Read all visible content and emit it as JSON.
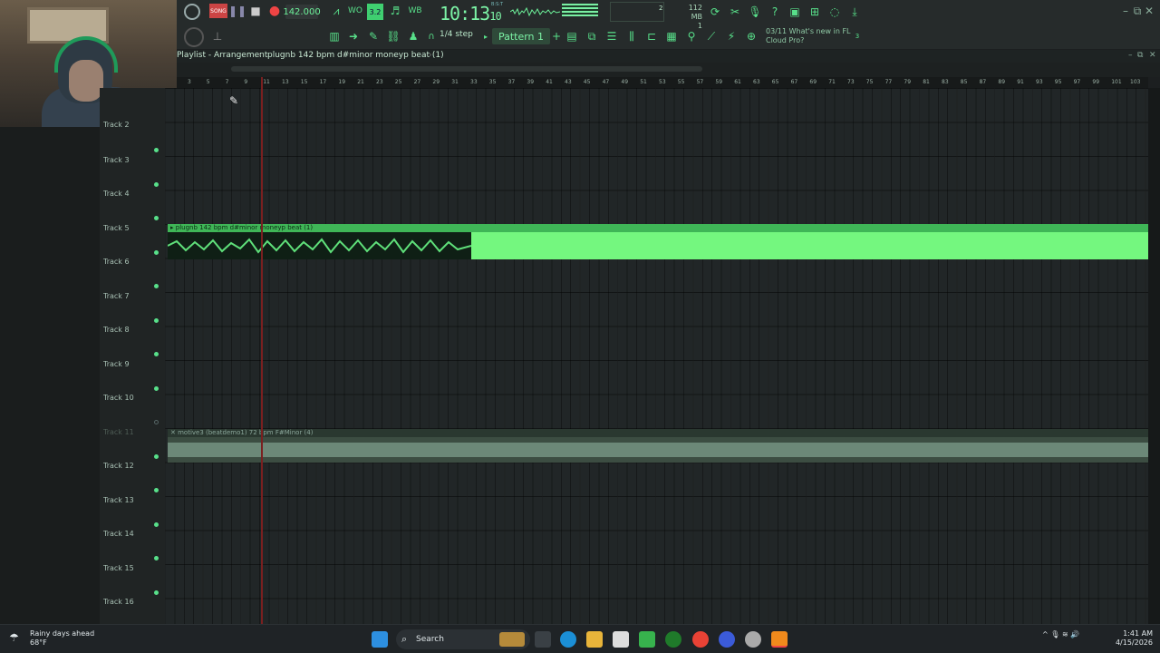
{
  "toolbar": {
    "tempo": "142.000",
    "clock_main": "10:13",
    "clock_sub": "10",
    "clock_sub_label": "B:S:T",
    "pattern_label": "Pattern 1",
    "snap_label": "1/4 step",
    "memory": "112 MB",
    "memory_sub": "1",
    "cpu_label": "2",
    "news_date": "03/11",
    "news_line1": "What's new in FL",
    "news_line2": "Cloud Pro?",
    "news_badge": "3"
  },
  "playlist": {
    "window_title": "Playlist - Arrangement",
    "arrangement_crumb": "plugnb 142 bpm d#minor moneyp beat (1)",
    "ruler": [
      "3",
      "5",
      "7",
      "9",
      "11",
      "13",
      "15",
      "17",
      "19",
      "21",
      "23",
      "25",
      "27",
      "29",
      "31",
      "33",
      "35",
      "37",
      "39",
      "41",
      "43",
      "45",
      "47",
      "49",
      "51",
      "53",
      "55",
      "57",
      "59",
      "61",
      "63",
      "65",
      "67",
      "69",
      "71",
      "73",
      "75",
      "77",
      "79",
      "81",
      "83",
      "85",
      "87",
      "89",
      "91",
      "93",
      "95",
      "97",
      "99",
      "101",
      "103"
    ],
    "tracks": [
      {
        "label": "Track 2"
      },
      {
        "label": "Track 3"
      },
      {
        "label": "Track 4"
      },
      {
        "label": "Track 5"
      },
      {
        "label": "Track 6"
      },
      {
        "label": "Track 7"
      },
      {
        "label": "Track 8"
      },
      {
        "label": "Track 9"
      },
      {
        "label": "Track 10"
      },
      {
        "label": "Track 11"
      },
      {
        "label": "Track 12"
      },
      {
        "label": "Track 13"
      },
      {
        "label": "Track 14"
      },
      {
        "label": "Track 15"
      },
      {
        "label": "Track 16"
      }
    ],
    "clip1_name": "plugnb 142 bpm d#minor moneyp beat (1)",
    "clip2_name": "motive3 (beatdemo1) 72 bpm F#Minor (4)"
  },
  "taskbar": {
    "weather_title": "Rainy days ahead",
    "weather_temp": "68°F",
    "search_label": "Search",
    "time": "1:41 AM",
    "date": "4/15/2026"
  },
  "colors": {
    "accent": "#58e08a",
    "clip_green": "#74f77f",
    "playhead": "#7a2020",
    "grid_bg": "#212627"
  }
}
